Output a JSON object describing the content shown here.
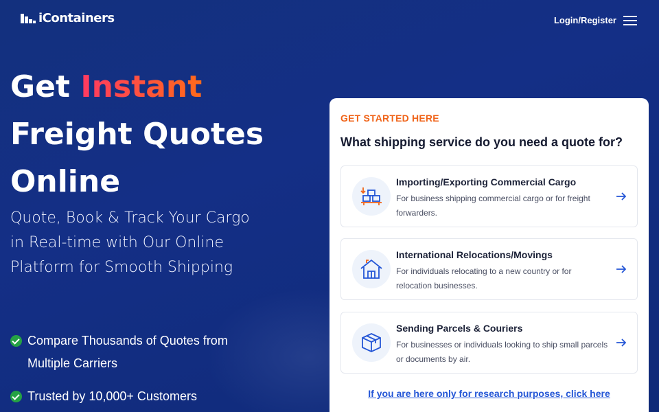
{
  "header": {
    "logo_text": "iContainers",
    "login_label": "Login/Register"
  },
  "hero": {
    "title_pre": "Get ",
    "title_accent": "Instant",
    "title_line2": "Freight Quotes",
    "title_line3": "Online",
    "subtitle": "Quote, Book & Track Your Cargo in Real-time with Our Online Platform for Smooth Shipping",
    "features": [
      "Compare Thousands of Quotes from Multiple Carriers",
      "Trusted by 10,000+ Customers"
    ]
  },
  "card": {
    "eyebrow": "GET STARTED HERE",
    "question": "What shipping service do you need a quote for?",
    "options": [
      {
        "title": "Importing/Exporting Commercial Cargo",
        "desc": "For business shipping commercial cargo or for freight forwarders.",
        "icon": "cargo-icon"
      },
      {
        "title": "International Relocations/Movings",
        "desc": "For individuals relocating to a new country or for relocation businesses.",
        "icon": "house-icon"
      },
      {
        "title": "Sending Parcels & Couriers",
        "desc": "For businesses or individuals looking to ship small parcels or documents by air.",
        "icon": "box-icon"
      }
    ],
    "research_link": "If you are here only for research purposes, click here"
  },
  "colors": {
    "background": "#142f86",
    "accent_orange": "#f06318",
    "link_blue": "#2456d6",
    "check_green": "#25a244"
  }
}
